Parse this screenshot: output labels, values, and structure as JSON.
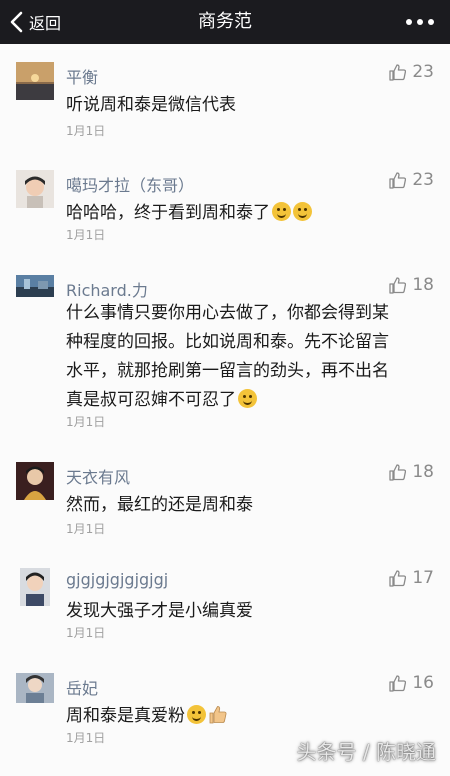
{
  "nav": {
    "back_label": "返回",
    "title": "商务范"
  },
  "comments": [
    {
      "nickname": "平衡",
      "likes": "23",
      "lines": [
        "听说周和泰是微信代表"
      ],
      "date": "1月1日"
    },
    {
      "nickname": "噶玛才拉（东哥）",
      "likes": "23",
      "lines": [
        "哈哈哈，终于看到周和泰了"
      ],
      "date": "1月1日"
    },
    {
      "nickname": "Richard.力",
      "likes": "18",
      "lines": [
        "什么事情只要你用心去做了，你都会得到某",
        "种程度的回报。比如说周和泰。先不论留言",
        "水平，就那抢刷第一留言的劲头，再不出名",
        "真是叔可忍婶不可忍了"
      ],
      "date": "1月1日"
    },
    {
      "nickname": "天衣有风",
      "likes": "18",
      "lines": [
        "然而，最红的还是周和泰"
      ],
      "date": "1月1日"
    },
    {
      "nickname": "gjgjgjgjgjgjgj",
      "likes": "17",
      "lines": [
        "发现大强子才是小编真爱"
      ],
      "date": "1月1日"
    },
    {
      "nickname": "岳妃",
      "likes": "16",
      "lines": [
        "周和泰是真爱粉"
      ],
      "date": "1月1日"
    }
  ],
  "watermark": "头条号 / 陈晓通"
}
